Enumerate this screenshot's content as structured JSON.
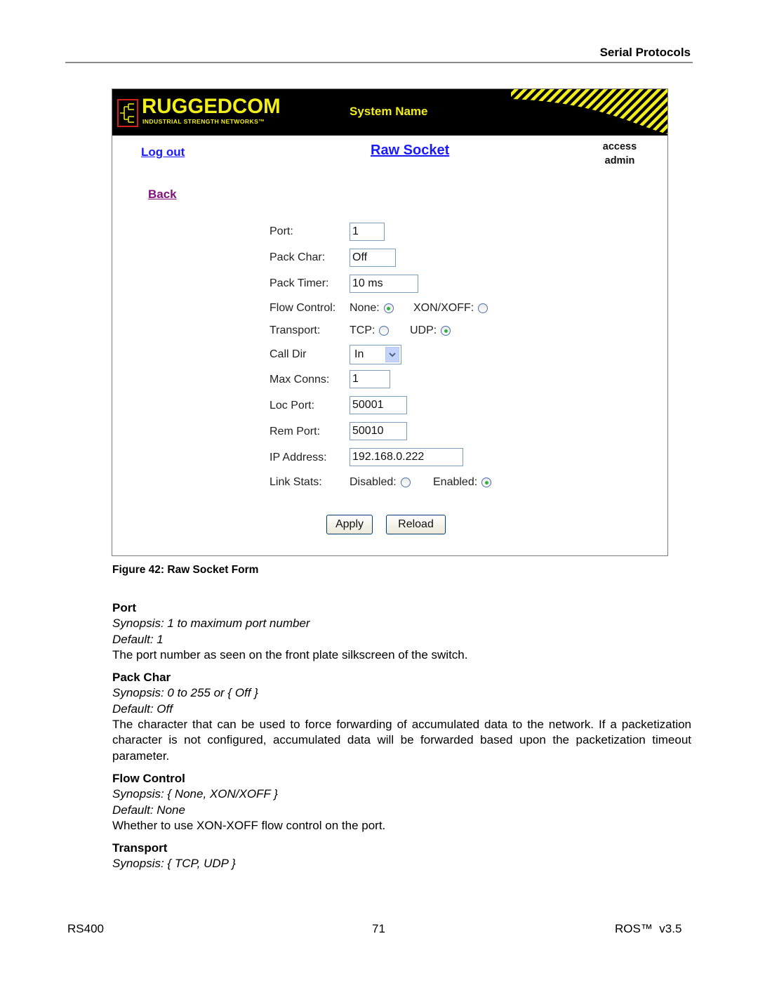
{
  "page_header": {
    "title": "Serial Protocols"
  },
  "figure": {
    "banner": {
      "logo_word": "RUGGEDCOM",
      "logo_tagline": "INDUSTRIAL STRENGTH NETWORKS™",
      "system_name": "System Name",
      "brand_color": "#f2ee1c"
    },
    "nav": {
      "logout_label": "Log out",
      "page_title": "Raw Socket",
      "access_label": "access",
      "access_value": "admin",
      "back_label": "Back"
    },
    "form": {
      "port": {
        "label": "Port:",
        "value": "1"
      },
      "pack_char": {
        "label": "Pack Char:",
        "value": "Off"
      },
      "pack_timer": {
        "label": "Pack Timer:",
        "value": "10 ms"
      },
      "flow_control": {
        "label": "Flow Control:",
        "options": [
          {
            "label": "None:",
            "selected": true
          },
          {
            "label": "XON/XOFF:",
            "selected": false
          }
        ]
      },
      "transport": {
        "label": "Transport:",
        "options": [
          {
            "label": "TCP:",
            "selected": false
          },
          {
            "label": "UDP:",
            "selected": true
          }
        ]
      },
      "call_dir": {
        "label": "Call Dir",
        "value": "In"
      },
      "max_conns": {
        "label": "Max Conns:",
        "value": "1"
      },
      "loc_port": {
        "label": "Loc Port:",
        "value": "50001"
      },
      "rem_port": {
        "label": "Rem Port:",
        "value": "50010"
      },
      "ip_address": {
        "label": "IP Address:",
        "value": "192.168.0.222"
      },
      "link_stats": {
        "label": "Link Stats:",
        "options": [
          {
            "label": "Disabled:",
            "selected": false
          },
          {
            "label": "Enabled:",
            "selected": true
          }
        ]
      },
      "apply_label": "Apply",
      "reload_label": "Reload"
    },
    "caption": "Figure 42: Raw Socket Form"
  },
  "sections": [
    {
      "heading": "Port",
      "synopsis": "Synopsis: 1 to maximum port number",
      "default": "Default: 1",
      "description": "The port number as seen on the front plate silkscreen of the switch."
    },
    {
      "heading": "Pack Char",
      "synopsis": "Synopsis: 0 to 255 or { Off }",
      "default": "Default: Off",
      "description": "The character that can be used to force forwarding of accumulated data to the network. If a packetization character is not configured, accumulated data will be forwarded based upon the packetization timeout parameter."
    },
    {
      "heading": "Flow Control",
      "synopsis": "Synopsis: { None, XON/XOFF }",
      "default": "Default: None",
      "description": "Whether to use XON-XOFF flow control on the port."
    },
    {
      "heading": "Transport",
      "synopsis": "Synopsis: { TCP, UDP }"
    }
  ],
  "footer": {
    "left": "RS400",
    "center": "71",
    "right": "ROS™  v3.5"
  }
}
